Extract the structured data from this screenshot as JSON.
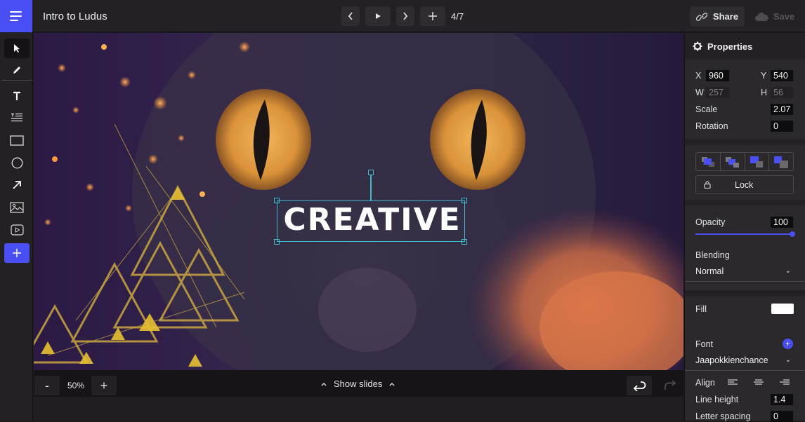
{
  "app": {
    "title": "Intro to Ludus",
    "slide_counter": "4/7",
    "share_label": "Share",
    "save_label": "Save",
    "accent_color": "#4a4ff5",
    "selection_color": "#3fbcd0"
  },
  "header_icons": {
    "menu": "hamburger-icon",
    "prev": "chevron-left-icon",
    "play": "play-icon",
    "next": "chevron-right-icon",
    "add": "plus-icon",
    "share": "link-icon",
    "save": "cloud-icon"
  },
  "toolbar": {
    "tools": [
      {
        "name": "select",
        "icon": "cursor-arrow-icon",
        "active": true
      },
      {
        "name": "pen",
        "icon": "pencil-icon"
      },
      {
        "name": "text",
        "icon": "text-icon"
      },
      {
        "name": "paragraph",
        "icon": "paragraph-icon"
      },
      {
        "name": "rectangle",
        "icon": "rectangle-icon"
      },
      {
        "name": "ellipse",
        "icon": "circle-icon"
      },
      {
        "name": "arrow",
        "icon": "arrow-icon"
      },
      {
        "name": "image",
        "icon": "image-icon"
      },
      {
        "name": "video",
        "icon": "video-icon"
      },
      {
        "name": "add",
        "icon": "plus-icon"
      }
    ]
  },
  "canvas": {
    "selected_text": "CREATIVE",
    "background_description": "Cat face with amber eyes, gold triangles, orange smoke"
  },
  "bottom": {
    "zoom_out": "-",
    "zoom_value": "50%",
    "zoom_in": "+",
    "show_slides_label": "Show slides",
    "undo_icon": "undo-icon",
    "redo_icon": "redo-icon"
  },
  "properties": {
    "title": "Properties",
    "x_label": "X",
    "x_value": "960",
    "y_label": "Y",
    "y_value": "540",
    "w_label": "W",
    "w_value": "257",
    "h_label": "H",
    "h_value": "56",
    "scale_label": "Scale",
    "scale_value": "2.07",
    "rotation_label": "Rotation",
    "rotation_value": "0",
    "order_buttons": [
      "send-to-back",
      "send-backward",
      "bring-forward",
      "bring-to-front"
    ],
    "lock_label": "Lock",
    "opacity_label": "Opacity",
    "opacity_value": "100",
    "opacity_fraction": 1.0,
    "blending_label": "Blending",
    "blending_value": "Normal",
    "fill_label": "Fill",
    "fill_color": "#ffffff",
    "font_label": "Font",
    "font_value": "Jaapokkienchance",
    "align_label": "Align",
    "line_height_label": "Line height",
    "line_height_value": "1.4",
    "letter_spacing_label": "Letter spacing",
    "letter_spacing_value": "0"
  }
}
